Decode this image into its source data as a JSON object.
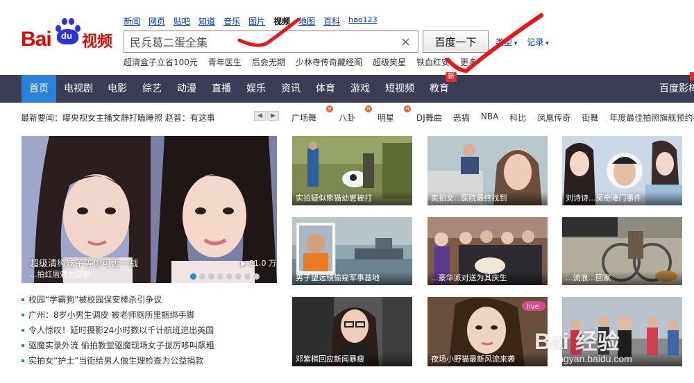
{
  "logo": {
    "bai": "Bai",
    "du": "du",
    "channel": "视频"
  },
  "top_nav": [
    {
      "label": "新闻",
      "active": false
    },
    {
      "label": "网页",
      "active": false
    },
    {
      "label": "贴吧",
      "active": false
    },
    {
      "label": "知道",
      "active": false
    },
    {
      "label": "音乐",
      "active": false
    },
    {
      "label": "图片",
      "active": false
    },
    {
      "label": "视频",
      "active": true
    },
    {
      "label": "地图",
      "active": false
    },
    {
      "label": "百科",
      "active": false
    },
    {
      "label": "hao123",
      "active": false
    }
  ],
  "search": {
    "value": "民兵葛二蛋全集",
    "clear_icon": "×",
    "button_label": "百度一下"
  },
  "extra_links": {
    "genre": "类型",
    "history": "记录"
  },
  "hot_words": [
    "超清盒子立省100元",
    "青年医生",
    "后会无期",
    "少林寺传奇藏经阁",
    "超级笑星",
    "铁血红安",
    "更多"
  ],
  "channels": [
    {
      "label": "首页",
      "active": true
    },
    {
      "label": "电视剧"
    },
    {
      "label": "电影"
    },
    {
      "label": "综艺"
    },
    {
      "label": "动漫"
    },
    {
      "label": "直播"
    },
    {
      "label": "娱乐"
    },
    {
      "label": "资讯"
    },
    {
      "label": "体育"
    },
    {
      "label": "游戏"
    },
    {
      "label": "短视频"
    },
    {
      "label": "教育",
      "badge": "新"
    },
    {
      "label": "百度影棒"
    }
  ],
  "news_ticker": {
    "prefix": "最新要闻：",
    "text": "曝央视女主播文静打瞌睡照 赵普：有这事"
  },
  "tags": [
    {
      "label": "广场舞",
      "hot": true
    },
    {
      "label": "八卦",
      "hot": true
    },
    {
      "label": "明星",
      "hot": true
    },
    {
      "label": "DJ舞曲"
    },
    {
      "label": "恶搞"
    },
    {
      "label": "NBA"
    },
    {
      "label": "科比"
    },
    {
      "label": "凤凰传奇"
    },
    {
      "label": "街舞"
    },
    {
      "label": "年度最佳拍照旗舰预约有奖"
    }
  ],
  "feature": {
    "caption": "超级清纯妹子等你可否一战",
    "sub": "...拍红唇魅力四射",
    "duration": "81.0 万"
  },
  "news_list": [
    "校园“学霸狗”被校园保安棒杀引争议",
    "广州：8岁小男生调皮 被老师厕所里捆绑手脚",
    "令人惊叹！延时摄影24小时数以千计航班进出英国",
    "驱魔实录外流 偷拍教堂驱魔现场女子拔厉哆叫飙粗",
    "实拍女“护士”当街给男人做生理检查为公益捐款"
  ],
  "thumbs": [
    {
      "caption": "实拍疑似熊猫幼崽被打"
    },
    {
      "caption": "实拍女...医院最终找到"
    },
    {
      "caption": "刘诗诗...吴奇隆门事件"
    },
    {
      "caption": "男子望远镜偷窥军事基地"
    },
    {
      "caption": "...豪华派对送为其庆生"
    },
    {
      "caption": "...流浪...回家"
    },
    {
      "caption": "邓紫棋回应新闻暴瘦"
    },
    {
      "caption": "夜场小野猫最新风流来袭"
    },
    {
      "caption": ""
    }
  ],
  "live_badge": "live",
  "watermark": {
    "main": "Bai 经验",
    "sub": "jingyan.baidu.com"
  }
}
